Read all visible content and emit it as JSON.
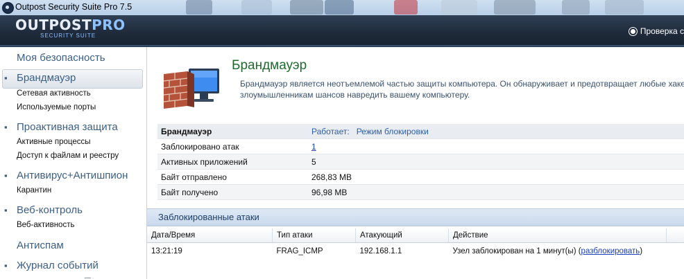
{
  "window": {
    "title": "Outpost Security Suite Pro 7.5"
  },
  "header": {
    "logo_main": "OUTPOST",
    "logo_pro": "PRO",
    "logo_sub": "SECURITY SUITE",
    "update_label": "Проверка с"
  },
  "sidebar": {
    "items": [
      {
        "label": "Моя безопасность",
        "type": "category"
      },
      {
        "label": "Брандмауэр",
        "type": "category",
        "active": true
      },
      {
        "label": "Сетевая активность",
        "type": "sub"
      },
      {
        "label": "Используемые порты",
        "type": "sub"
      },
      {
        "label": "Проактивная защита",
        "type": "category"
      },
      {
        "label": "Активные процессы",
        "type": "sub"
      },
      {
        "label": "Доступ к файлам и реестру",
        "type": "sub"
      },
      {
        "label": "Антивирус+Антишпион",
        "type": "category"
      },
      {
        "label": "Карантин",
        "type": "sub"
      },
      {
        "label": "Веб-контроль",
        "type": "category"
      },
      {
        "label": "Веб-активность",
        "type": "sub"
      },
      {
        "label": "Антиспам",
        "type": "category"
      },
      {
        "label": "Журнал событий",
        "type": "category"
      }
    ]
  },
  "main": {
    "title": "Брандмауэр",
    "description": "Брандмауэр является неотъемлемой частью защиты компьютера. Он обнаруживает и предотвращает любые хакер злоумышленникам шансов навредить вашему компьютеру.",
    "info": {
      "rows": [
        {
          "label": "Брандмауэр",
          "value": "Работает:",
          "extra": "Режим блокировки"
        },
        {
          "label": "Заблокировано атак",
          "value": "1"
        },
        {
          "label": "Активных приложений",
          "value": "5"
        },
        {
          "label": "Байт отправлено",
          "value": "268,83 MB"
        },
        {
          "label": "Байт получено",
          "value": "96,98 MB"
        }
      ]
    },
    "blocked_section_title": "Заблокированные атаки",
    "attacks": {
      "columns": [
        "Дата/Время",
        "Тип атаки",
        "Атакующий",
        "Действие"
      ],
      "rows": [
        {
          "time": "13:21:19",
          "type": "FRAG_ICMP",
          "attacker": "192.168.1.1",
          "action": "Узел заблокирован на 1 минут(ы) (",
          "link": "разблокировать",
          "after": ")"
        }
      ]
    }
  },
  "colors": {
    "header_bg": "#1f2b3b",
    "title_green": "#1e6a2e",
    "link_blue": "#2b5ea8",
    "nav_blue": "#3b5f86"
  },
  "icons": {
    "app": "outpost-app-icon",
    "firewall": "brick-wall-monitor-icon",
    "update": "update-check-icon"
  }
}
